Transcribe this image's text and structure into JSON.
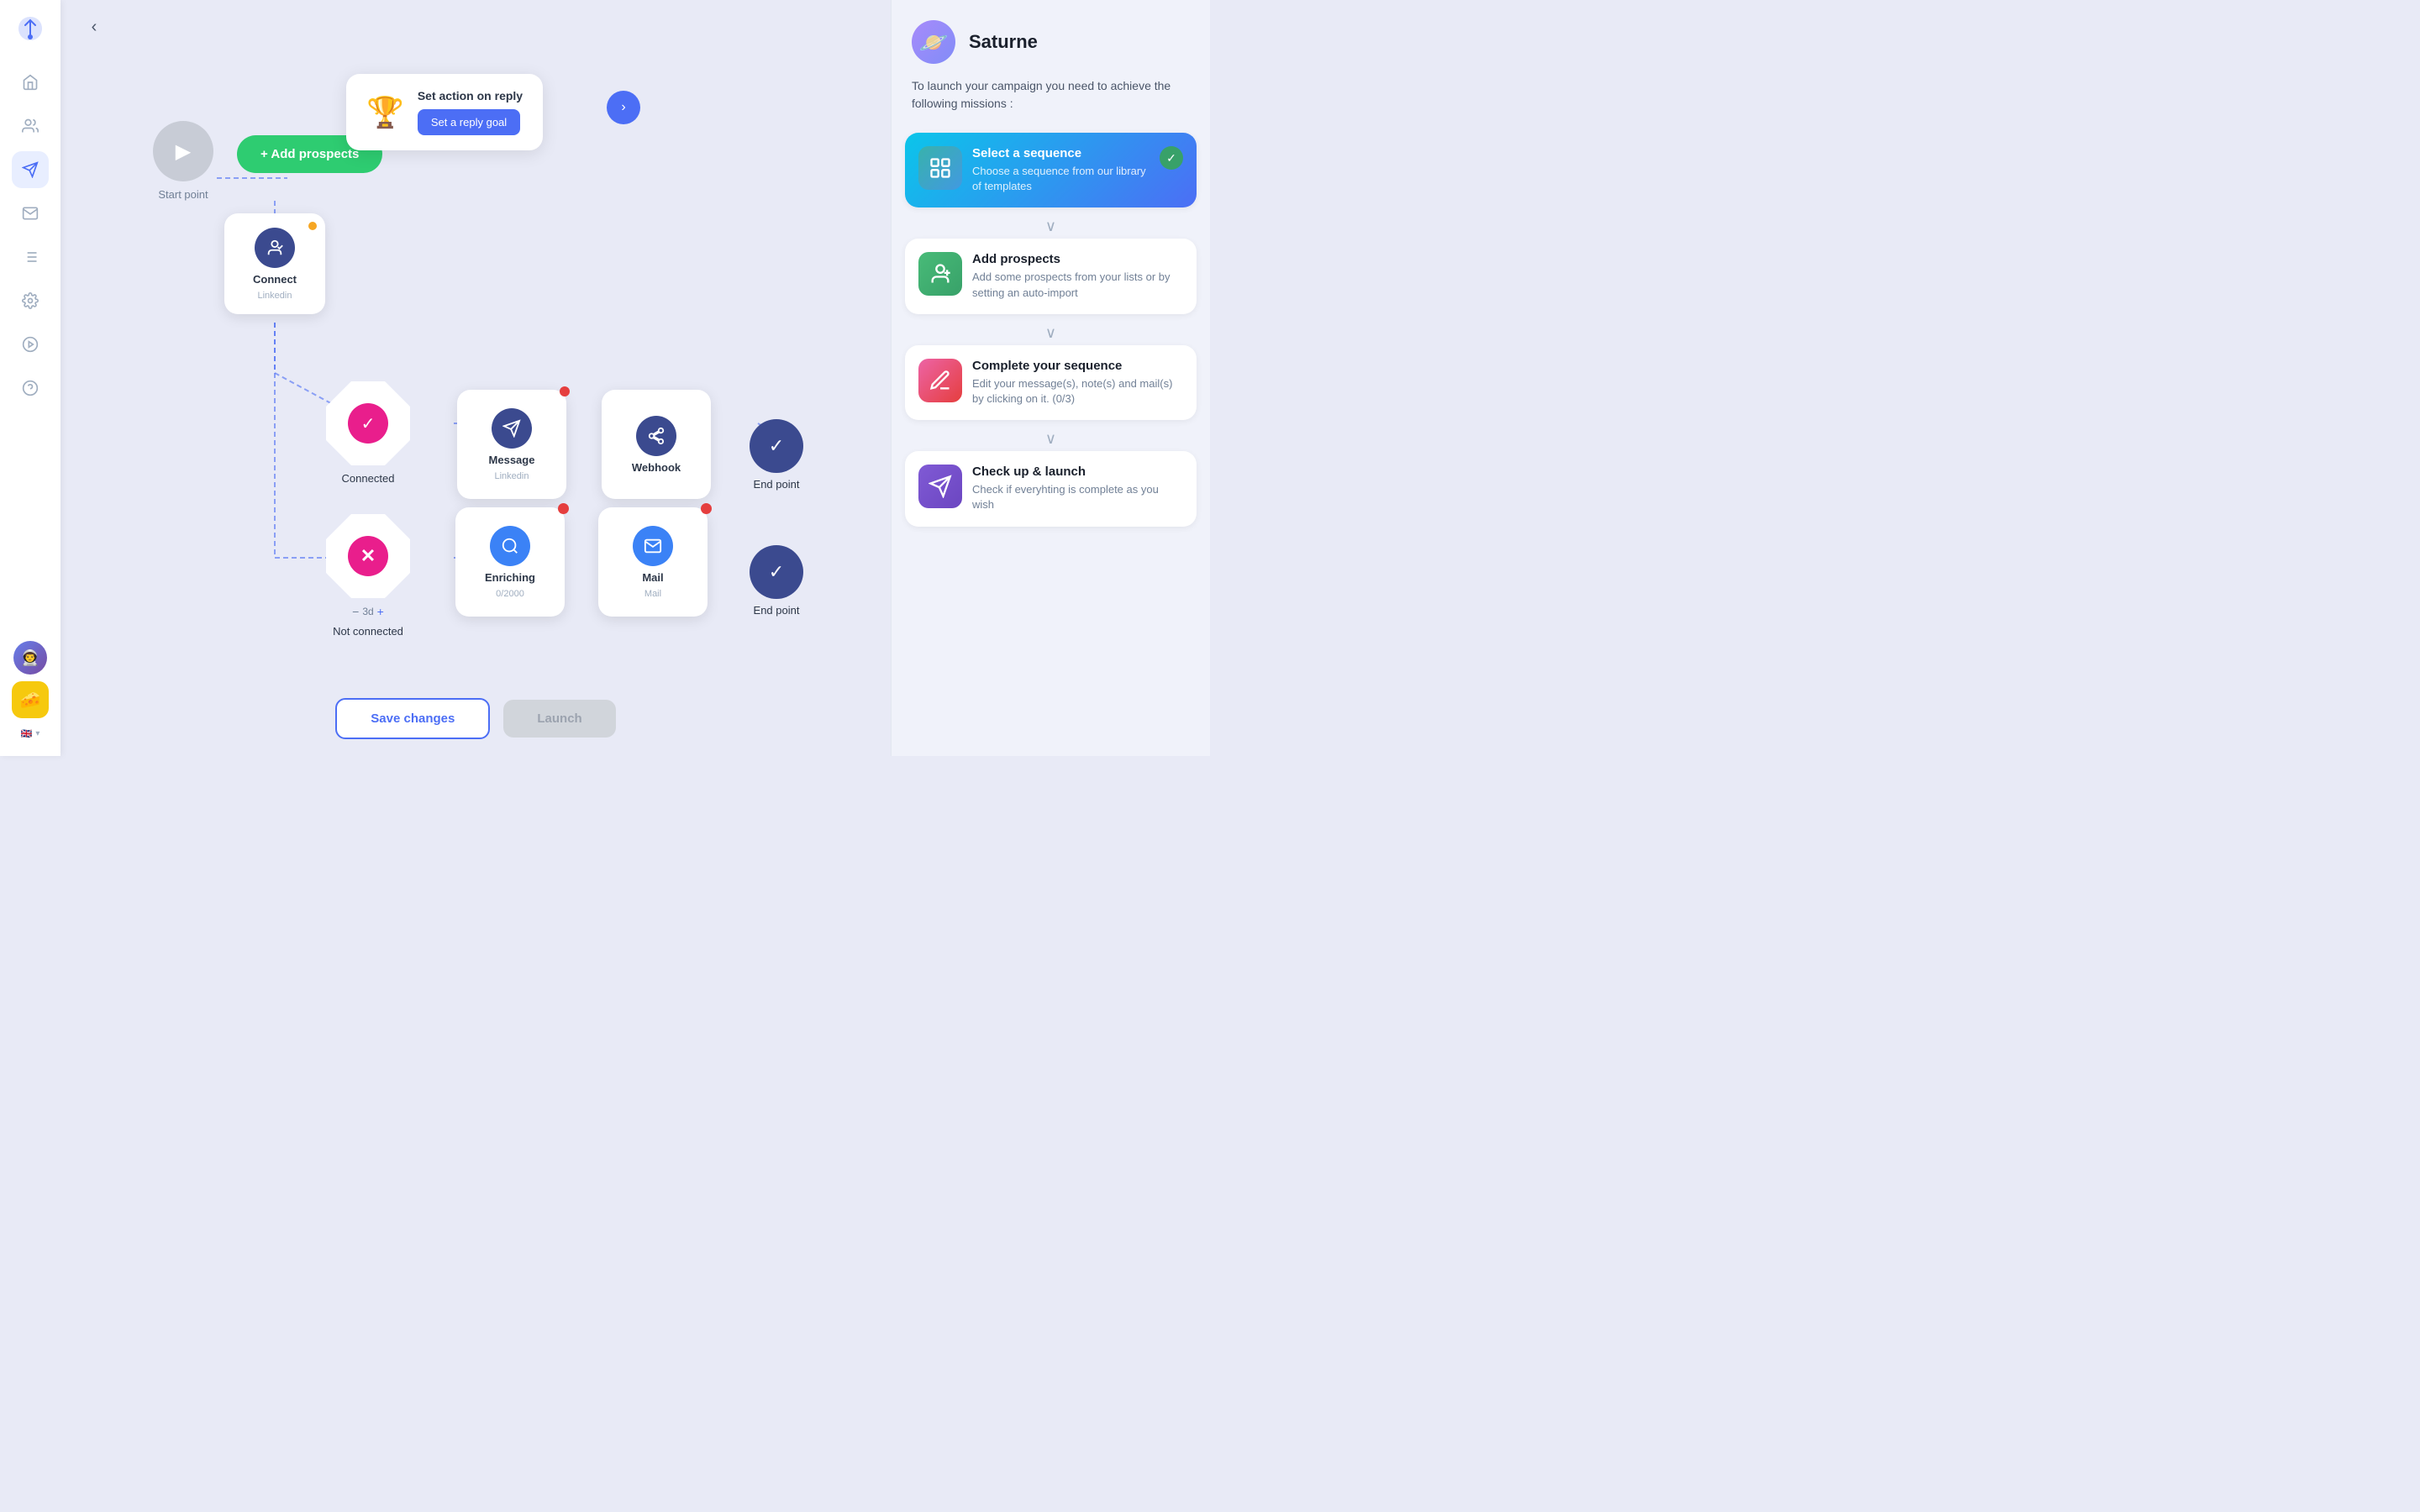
{
  "sidebar": {
    "logo": "🐦",
    "items": [
      {
        "id": "home",
        "icon": "⌂",
        "active": false
      },
      {
        "id": "team",
        "icon": "👥",
        "active": false
      },
      {
        "id": "campaigns",
        "icon": "🚀",
        "active": true
      },
      {
        "id": "mail",
        "icon": "✉",
        "active": false
      },
      {
        "id": "list",
        "icon": "≡",
        "active": false
      },
      {
        "id": "settings",
        "icon": "⚙",
        "active": false
      },
      {
        "id": "play",
        "icon": "▶",
        "active": false
      },
      {
        "id": "help",
        "icon": "?",
        "active": false
      }
    ],
    "lang": "EN",
    "badge": "🧀"
  },
  "topbar": {
    "back_label": "‹"
  },
  "action_on_reply": {
    "title": "Set action on reply",
    "button": "Set a reply goal",
    "trophy": "🏆"
  },
  "start_point": {
    "label": "Start point"
  },
  "add_prospects_btn": {
    "label": "+ Add prospects"
  },
  "connect_node": {
    "title": "Connect",
    "subtitle": "Linkedin"
  },
  "connected_node": {
    "label": "Connected"
  },
  "not_connected_node": {
    "label": "Not connected",
    "timer": "3d"
  },
  "message_node": {
    "title": "Message",
    "subtitle": "Linkedin"
  },
  "webhook_node": {
    "title": "Webhook"
  },
  "enriching_node": {
    "title": "Enriching",
    "subtitle": "0/2000"
  },
  "mail_node": {
    "title": "Mail",
    "subtitle": "Mail"
  },
  "end_points": [
    {
      "label": "End point"
    },
    {
      "label": "End point"
    }
  ],
  "bottom_bar": {
    "save_label": "Save changes",
    "launch_label": "Launch"
  },
  "right_panel": {
    "avatar_emoji": "🪐",
    "title": "Saturne",
    "description": "To launch your campaign you need to achieve the following missions :",
    "missions": [
      {
        "id": "select-sequence",
        "title": "Select a sequence",
        "desc": "Choose a sequence from our library of templates",
        "icon_type": "teal",
        "icon_emoji": "📊",
        "active": true,
        "checked": true
      },
      {
        "id": "add-prospects",
        "title": "Add prospects",
        "desc": "Add some prospects from your lists or by setting an auto-import",
        "icon_type": "green",
        "icon_emoji": "👤",
        "active": false,
        "checked": false
      },
      {
        "id": "complete-sequence",
        "title": "Complete your sequence",
        "desc": "Edit your message(s), note(s) and mail(s) by clicking on it. (0/3)",
        "icon_type": "pink",
        "icon_emoji": "✏️",
        "active": false,
        "checked": false
      },
      {
        "id": "check-launch",
        "title": "Check up & launch",
        "desc": "Check if everyhting is complete as you wish",
        "icon_type": "purple",
        "icon_emoji": "🚀",
        "active": false,
        "checked": false
      }
    ]
  }
}
